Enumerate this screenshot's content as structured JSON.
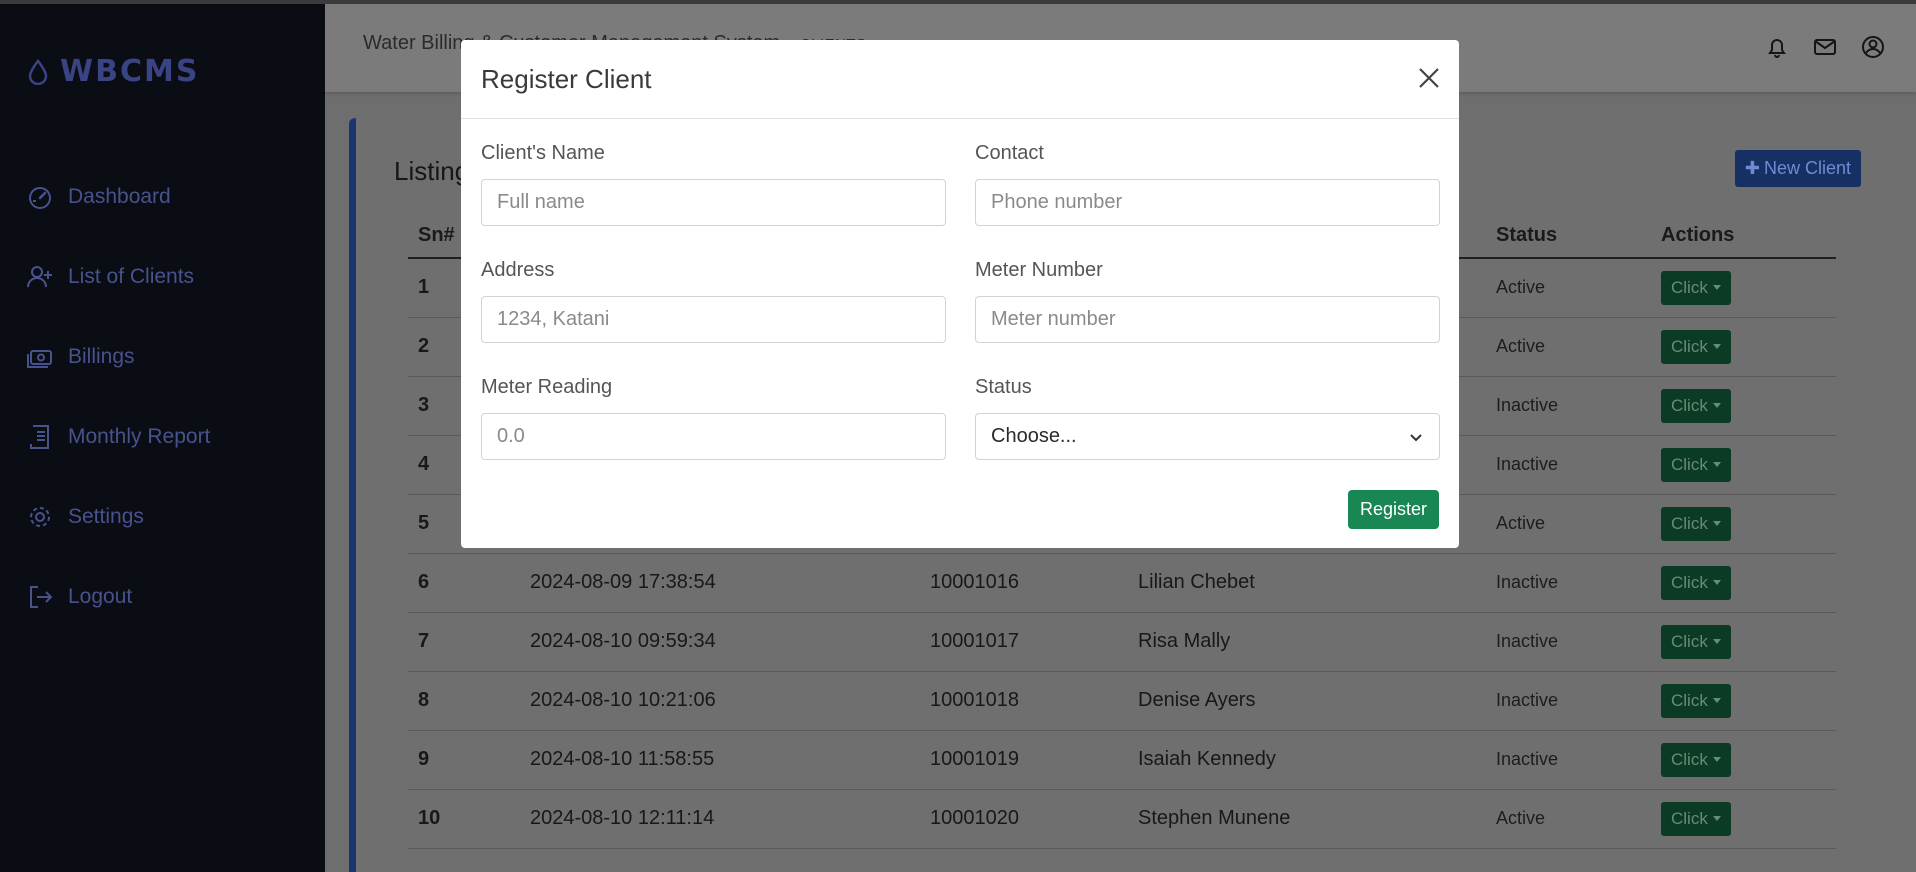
{
  "app": {
    "brand": "WBCMS"
  },
  "sidebar": {
    "items": [
      {
        "label": "Dashboard",
        "icon": "gauge-icon"
      },
      {
        "label": "List of Clients",
        "icon": "add-user-icon"
      },
      {
        "label": "Billings",
        "icon": "money-icon"
      },
      {
        "label": "Monthly Report",
        "icon": "receipt-icon"
      },
      {
        "label": "Settings",
        "icon": "gear-icon"
      },
      {
        "label": "Logout",
        "icon": "logout-icon"
      }
    ]
  },
  "topbar": {
    "title": "Water Billing & Customer Management System",
    "section": "CLIENTS"
  },
  "listing": {
    "title": "Listing",
    "new_client_label": "New Client",
    "columns": [
      "Sn#",
      "",
      "",
      "",
      "Status",
      "Actions"
    ],
    "action_label": "Click",
    "rows": [
      {
        "sn": "1",
        "date": "",
        "meter": "",
        "name": "",
        "status": "Active"
      },
      {
        "sn": "2",
        "date": "",
        "meter": "",
        "name": "",
        "status": "Active"
      },
      {
        "sn": "3",
        "date": "",
        "meter": "",
        "name": "",
        "status": "Inactive"
      },
      {
        "sn": "4",
        "date": "",
        "meter": "",
        "name": "",
        "status": "Inactive"
      },
      {
        "sn": "5",
        "date": "",
        "meter": "",
        "name": "",
        "status": "Active"
      },
      {
        "sn": "6",
        "date": "2024-08-09 17:38:54",
        "meter": "10001016",
        "name": "Lilian Chebet",
        "status": "Inactive"
      },
      {
        "sn": "7",
        "date": "2024-08-10 09:59:34",
        "meter": "10001017",
        "name": "Risa Mally",
        "status": "Inactive"
      },
      {
        "sn": "8",
        "date": "2024-08-10 10:21:06",
        "meter": "10001018",
        "name": "Denise Ayers",
        "status": "Inactive"
      },
      {
        "sn": "9",
        "date": "2024-08-10 11:58:55",
        "meter": "10001019",
        "name": "Isaiah Kennedy",
        "status": "Inactive"
      },
      {
        "sn": "10",
        "date": "2024-08-10 12:11:14",
        "meter": "10001020",
        "name": "Stephen Munene",
        "status": "Active"
      }
    ]
  },
  "modal": {
    "title": "Register Client",
    "fields": {
      "name": {
        "label": "Client's Name",
        "placeholder": "Full name"
      },
      "contact": {
        "label": "Contact",
        "placeholder": "Phone number"
      },
      "address": {
        "label": "Address",
        "placeholder": "1234, Katani"
      },
      "meter_number": {
        "label": "Meter Number",
        "placeholder": "Meter number"
      },
      "meter_reading": {
        "label": "Meter Reading",
        "placeholder": "0.0"
      },
      "status": {
        "label": "Status",
        "selected": "Choose..."
      }
    },
    "submit_label": "Register"
  }
}
